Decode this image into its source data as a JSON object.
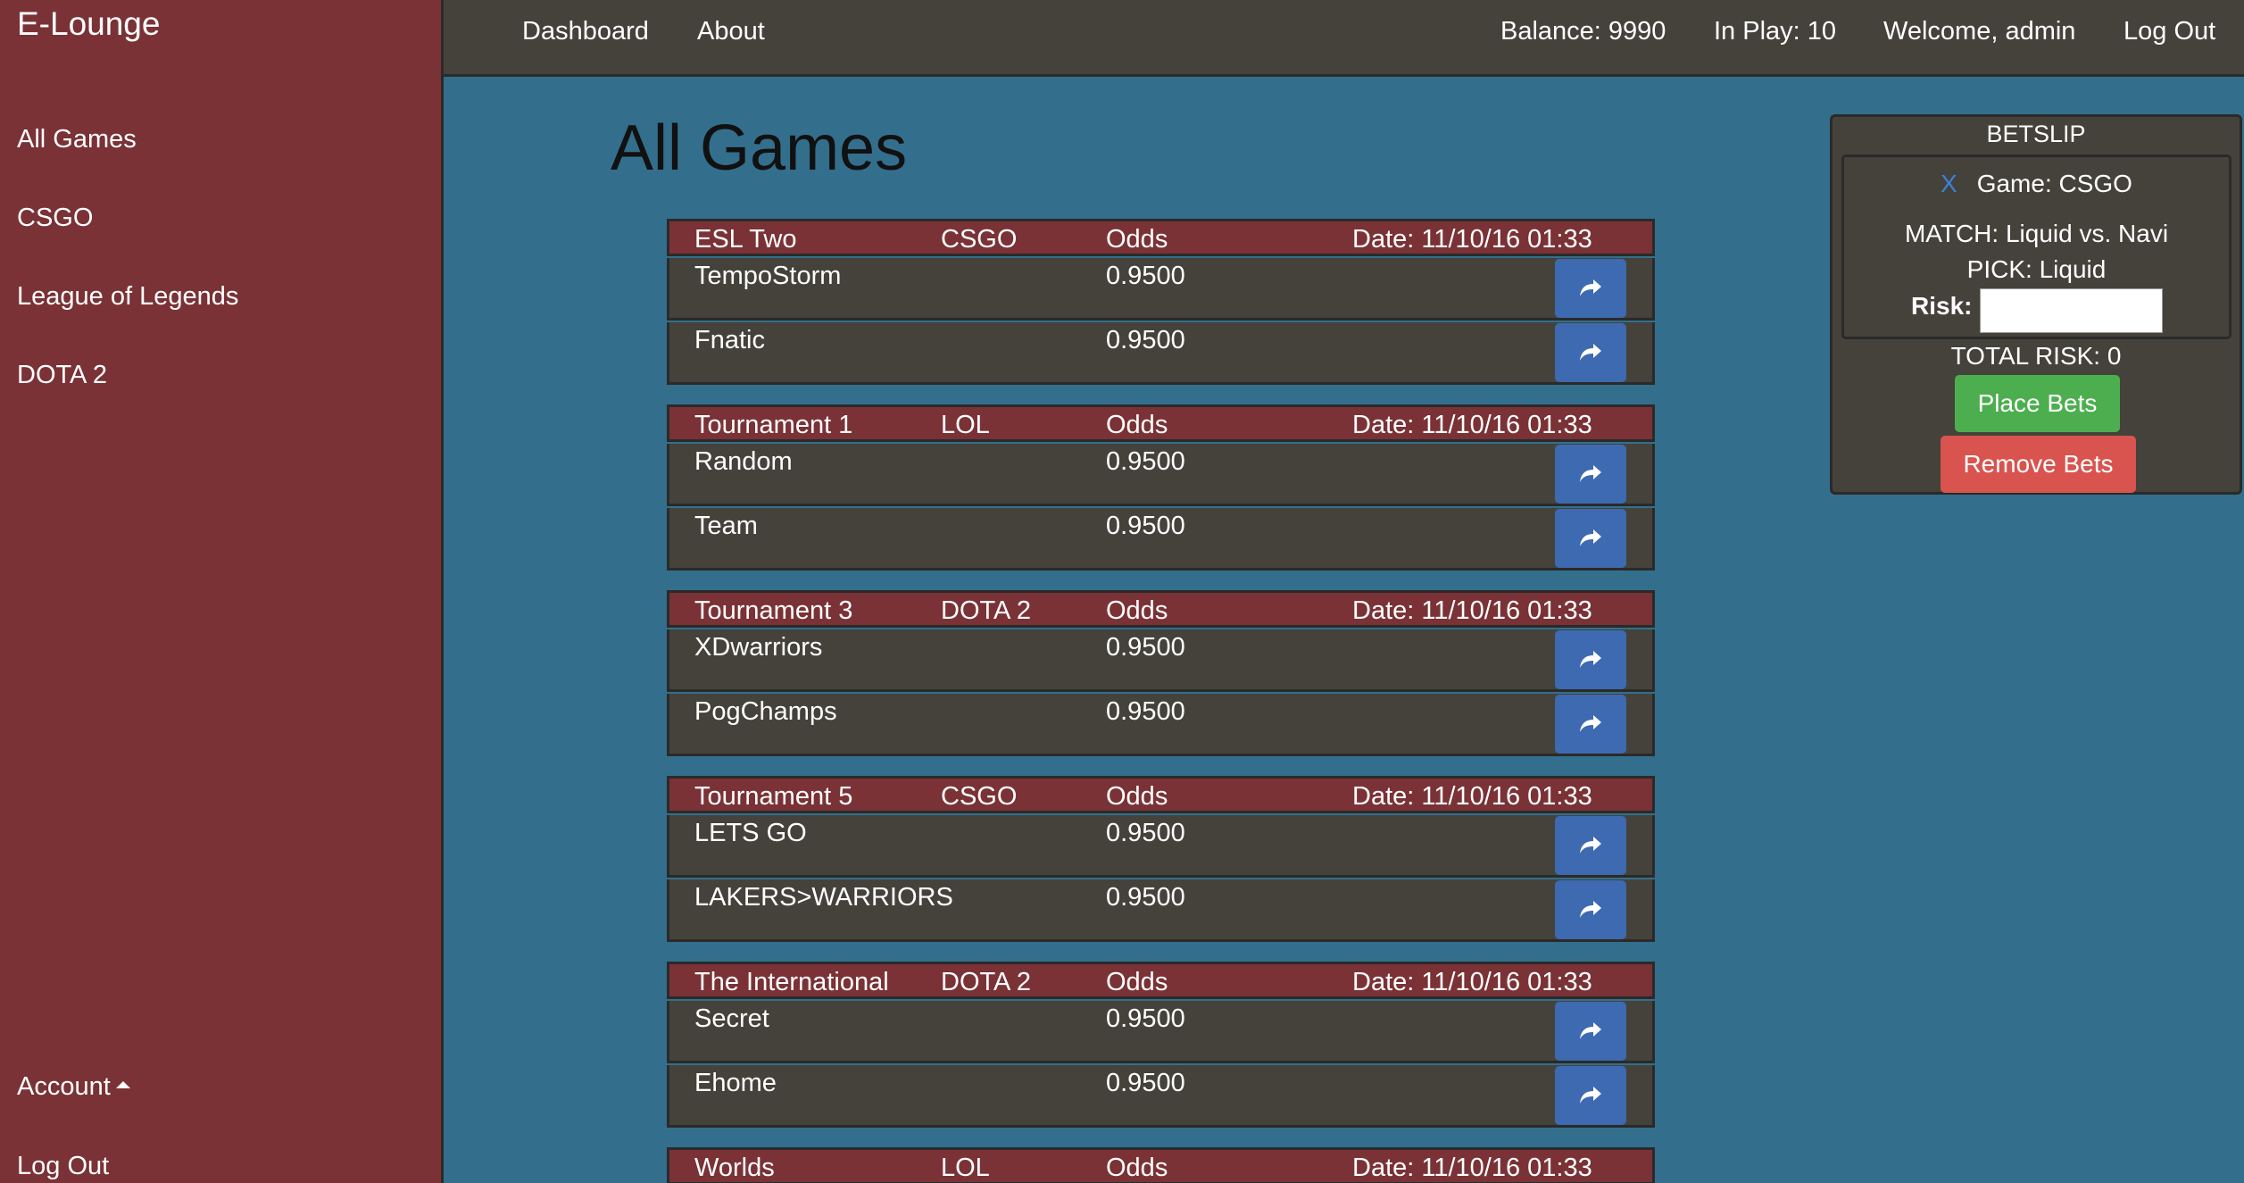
{
  "app": {
    "brand": "E-Lounge"
  },
  "sidebar": {
    "items": [
      {
        "label": "All Games"
      },
      {
        "label": "CSGO"
      },
      {
        "label": "League of Legends"
      },
      {
        "label": "DOTA 2"
      }
    ],
    "account_label": "Account",
    "logout_label": "Log Out"
  },
  "topnav": {
    "dashboard": "Dashboard",
    "about": "About",
    "balance": "Balance: 9990",
    "in_play": "In Play: 10",
    "welcome": "Welcome, admin",
    "logout": "Log Out"
  },
  "main": {
    "title": "All Games",
    "odds_header": "Odds",
    "games": [
      {
        "tournament": "ESL Two",
        "game": "CSGO",
        "date": "Date: 11/10/16 01:33",
        "teams": [
          {
            "name": "TempoStorm",
            "odds": "0.9500"
          },
          {
            "name": "Fnatic",
            "odds": "0.9500"
          }
        ]
      },
      {
        "tournament": "Tournament 1",
        "game": "LOL",
        "date": "Date: 11/10/16 01:33",
        "teams": [
          {
            "name": "Random",
            "odds": "0.9500"
          },
          {
            "name": "Team",
            "odds": "0.9500"
          }
        ]
      },
      {
        "tournament": "Tournament 3",
        "game": "DOTA 2",
        "date": "Date: 11/10/16 01:33",
        "teams": [
          {
            "name": "XDwarriors",
            "odds": "0.9500"
          },
          {
            "name": "PogChamps",
            "odds": "0.9500"
          }
        ]
      },
      {
        "tournament": "Tournament 5",
        "game": "CSGO",
        "date": "Date: 11/10/16 01:33",
        "teams": [
          {
            "name": "LETS GO",
            "odds": "0.9500"
          },
          {
            "name": "LAKERS>WARRIORS",
            "odds": "0.9500"
          }
        ]
      },
      {
        "tournament": "The International",
        "game": "DOTA 2",
        "date": "Date: 11/10/16 01:33",
        "teams": [
          {
            "name": "Secret",
            "odds": "0.9500"
          },
          {
            "name": "Ehome",
            "odds": "0.9500"
          }
        ]
      },
      {
        "tournament": "Worlds",
        "game": "LOL",
        "date": "Date: 11/10/16 01:33",
        "teams": []
      }
    ]
  },
  "betslip": {
    "title": "BETSLIP",
    "remove_x": "X",
    "game": "Game: CSGO",
    "match": "MATCH: Liquid vs. Navi",
    "pick": "PICK: Liquid",
    "risk_label": "Risk:",
    "risk_value": "",
    "total_risk": "TOTAL RISK: 0",
    "place_bets": "Place Bets",
    "remove_bets": "Remove Bets"
  },
  "colors": {
    "background": "#336f8c",
    "sidebar": "#7a3236",
    "panel": "#44423a",
    "bet_button": "#3d6ab0",
    "place_button": "#4cae4f",
    "remove_button": "#d9534f"
  }
}
